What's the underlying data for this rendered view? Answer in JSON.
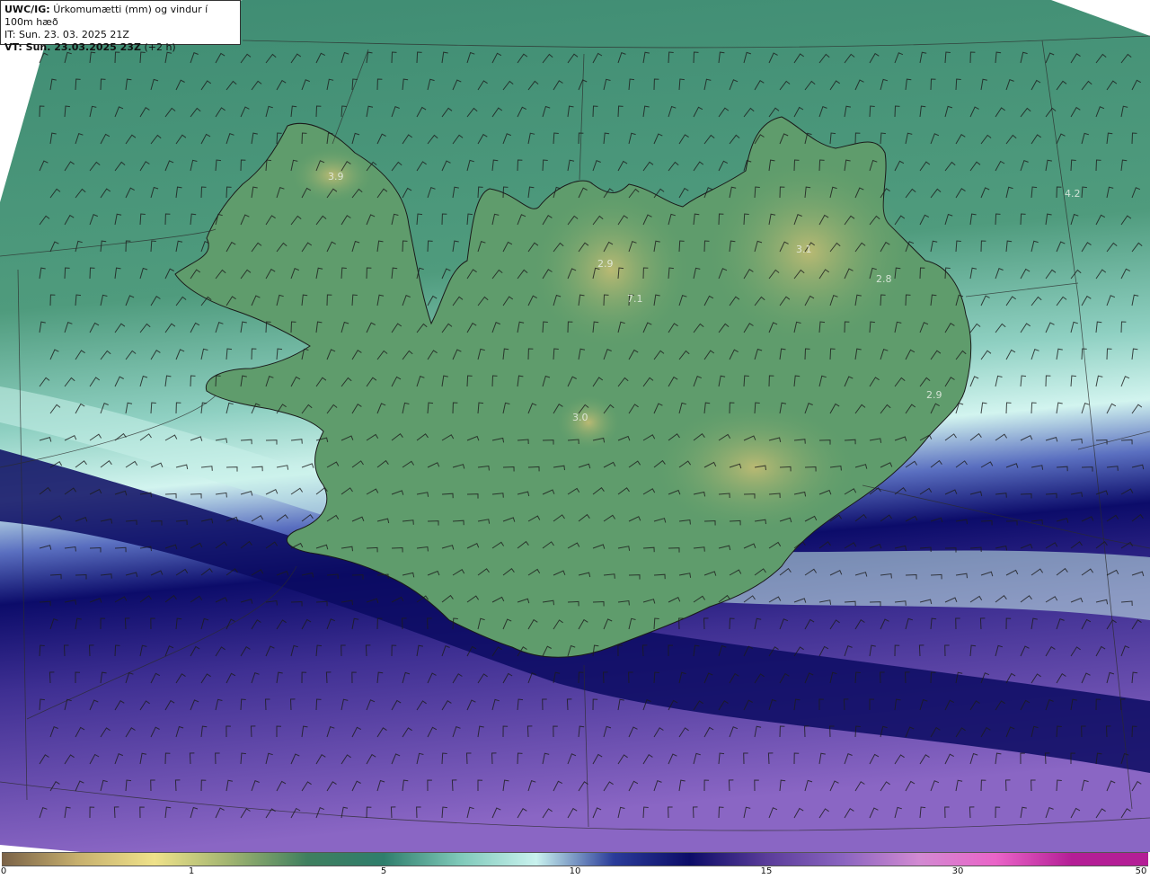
{
  "header": {
    "model": "UWC/IG:",
    "product": "Úrkomumætti (mm) og vindur í 100m hæð",
    "it_line": "IT: Sun. 23. 03. 2025 21Z",
    "vt_prefix": "VT: Sun. 23.03.2025 23Z",
    "vt_suffix": "(+2 h)"
  },
  "value_labels": [
    {
      "text": "3.9"
    },
    {
      "text": "2.9"
    },
    {
      "text": "7.1"
    },
    {
      "text": "3.0"
    },
    {
      "text": "3.1"
    },
    {
      "text": "2.8"
    },
    {
      "text": "2.9"
    },
    {
      "text": "4.2"
    }
  ],
  "colorbar": {
    "ticks": [
      "0",
      "1",
      "5",
      "10",
      "15",
      "30",
      "50"
    ],
    "colors": [
      "#7a6247",
      "#c7b06e",
      "#efe28a",
      "#9fb370",
      "#3f7f5f",
      "#2f7e6c",
      "#7fc9b9",
      "#c9f2ee",
      "#2a3c9a",
      "#0c0c68",
      "#5a3c9a",
      "#8a64c0",
      "#d28ad2",
      "#ea64c8",
      "#b41e96"
    ]
  },
  "colors": {
    "land_high": "#b6b46c",
    "land_mid": "#5e9c6a",
    "sea_north": "#3b8a72",
    "precip_light": "#bdebe6",
    "precip_heavy": "#0a0a64",
    "precip_south": "#7a58b8"
  }
}
